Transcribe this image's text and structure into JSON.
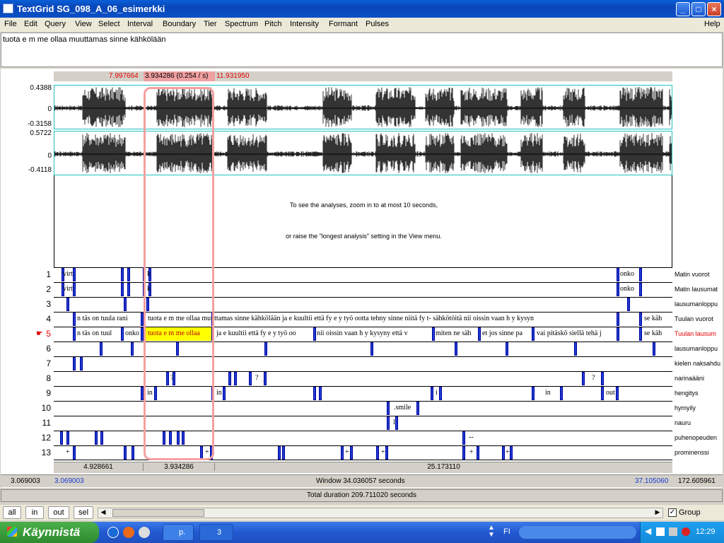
{
  "window": {
    "title": "TextGrid SG_098_A_06_esimerkki",
    "min": "_",
    "max": "□",
    "close": "×"
  },
  "menu": [
    "File",
    "Edit",
    "Query",
    "View",
    "Select",
    "Interval",
    "Boundary",
    "Tier",
    "Spectrum",
    "Pitch",
    "Intensity",
    "Formant",
    "Pulses",
    "Help"
  ],
  "text_field": "tuota e m me ollaa muuttamas sinne kähkölään",
  "selection": {
    "left": "7.997664",
    "mid": "3.934286 (0.254 / s)",
    "right": "11.931950"
  },
  "wave": {
    "ch1_max": "0.4388",
    "ch1_zero": "0",
    "ch1_min": "-0.3158",
    "ch2_max": "0.5722",
    "ch2_zero": "0",
    "ch2_min": "-0.4118"
  },
  "analysis_msg1": "To see the analyses, zoom in to at most 10 seconds,",
  "analysis_msg2": "or raise the \"longest analysis\" setting in the View menu.",
  "tiers": [
    {
      "num": "1",
      "name": "Matin vuorot",
      "texts": [
        [
          "virt",
          88
        ],
        [
          "onko",
          876
        ],
        [
          "k",
          207
        ]
      ]
    },
    {
      "num": "2",
      "name": "Matin lausumat",
      "texts": [
        [
          "virt",
          88
        ],
        [
          "onko",
          876
        ],
        [
          "k",
          207
        ]
      ]
    },
    {
      "num": "3",
      "name": "lausumanloppu",
      "texts": []
    },
    {
      "num": "4",
      "name": "Tuulan vuorot",
      "texts": [
        [
          "n täs on tuula rani",
          108
        ],
        [
          "tuota e m me ollaa muuttamas sinne kähkölään ja e kuultii että fy e y työ ootta tehny sinne niitä fy t- sähkötöitä nii oissin vaan h y kysyn",
          208
        ],
        [
          "se käh",
          910
        ]
      ]
    },
    {
      "num": "5",
      "name": "Tuulan lausum",
      "texts": [
        [
          "n täs on tuul",
          108
        ],
        [
          "onko",
          176
        ],
        [
          "tuota e m me ollaa",
          208
        ],
        [
          "ja e kuultii että fy e y työ oo",
          305
        ],
        [
          "nii oissin vaan h y kysyny että v",
          447
        ],
        [
          "miten ne säh",
          615
        ],
        [
          "et jos sinne pa",
          681
        ],
        [
          "vai pitäskö siellä tehä j",
          758
        ],
        [
          "se käh",
          910
        ]
      ]
    },
    {
      "num": "6",
      "name": "lausumanloppu",
      "texts": []
    },
    {
      "num": "7",
      "name": "kielen naksahdu",
      "texts": []
    },
    {
      "num": "8",
      "name": "narinaääni",
      "texts": [
        [
          "?",
          240
        ],
        [
          "?",
          360
        ],
        [
          "?",
          836
        ]
      ]
    },
    {
      "num": "9",
      "name": "hengitys",
      "texts": [
        [
          "in",
          207
        ],
        [
          "in",
          305
        ],
        [
          "i",
          615
        ],
        [
          "in",
          770
        ],
        [
          "out",
          856
        ]
      ]
    },
    {
      "num": "10",
      "name": "hymyily",
      "texts": [
        [
          ".smile",
          556
        ]
      ]
    },
    {
      "num": "11",
      "name": "nauru",
      "texts": [
        [
          "l",
          555
        ]
      ]
    },
    {
      "num": "12",
      "name": "puhenopeuden",
      "texts": [
        [
          "--",
          662
        ]
      ]
    },
    {
      "num": "13",
      "name": "prominenssi",
      "texts": [
        [
          "+",
          92
        ],
        [
          "+",
          289
        ],
        [
          "+",
          487
        ],
        [
          "+",
          538
        ],
        [
          "+",
          663
        ],
        [
          "+",
          714
        ]
      ]
    }
  ],
  "current_tier_marker": "☛",
  "segments": {
    "left": "4.928661",
    "mid": "3.934286",
    "right": "25.173110"
  },
  "window_row": {
    "start_outer": "3.069003",
    "start": "3.069003",
    "label": "Window 34.036057 seconds",
    "end": "37.105060",
    "end_outer": "172.605961"
  },
  "total": "Total duration 209.711020 seconds",
  "buttons": {
    "all": "all",
    "in": "in",
    "out": "out",
    "sel": "sel",
    "group": "Group"
  },
  "taskbar": {
    "start": "Käynnistä",
    "item1": "p.",
    "item2": "3",
    "lang": "FI",
    "clock": "12:29"
  },
  "colors": {
    "boundary": "#1f3fd0",
    "selection": "#f4a0a0",
    "highlight": "#ffff00",
    "red_text": "#e00000"
  }
}
